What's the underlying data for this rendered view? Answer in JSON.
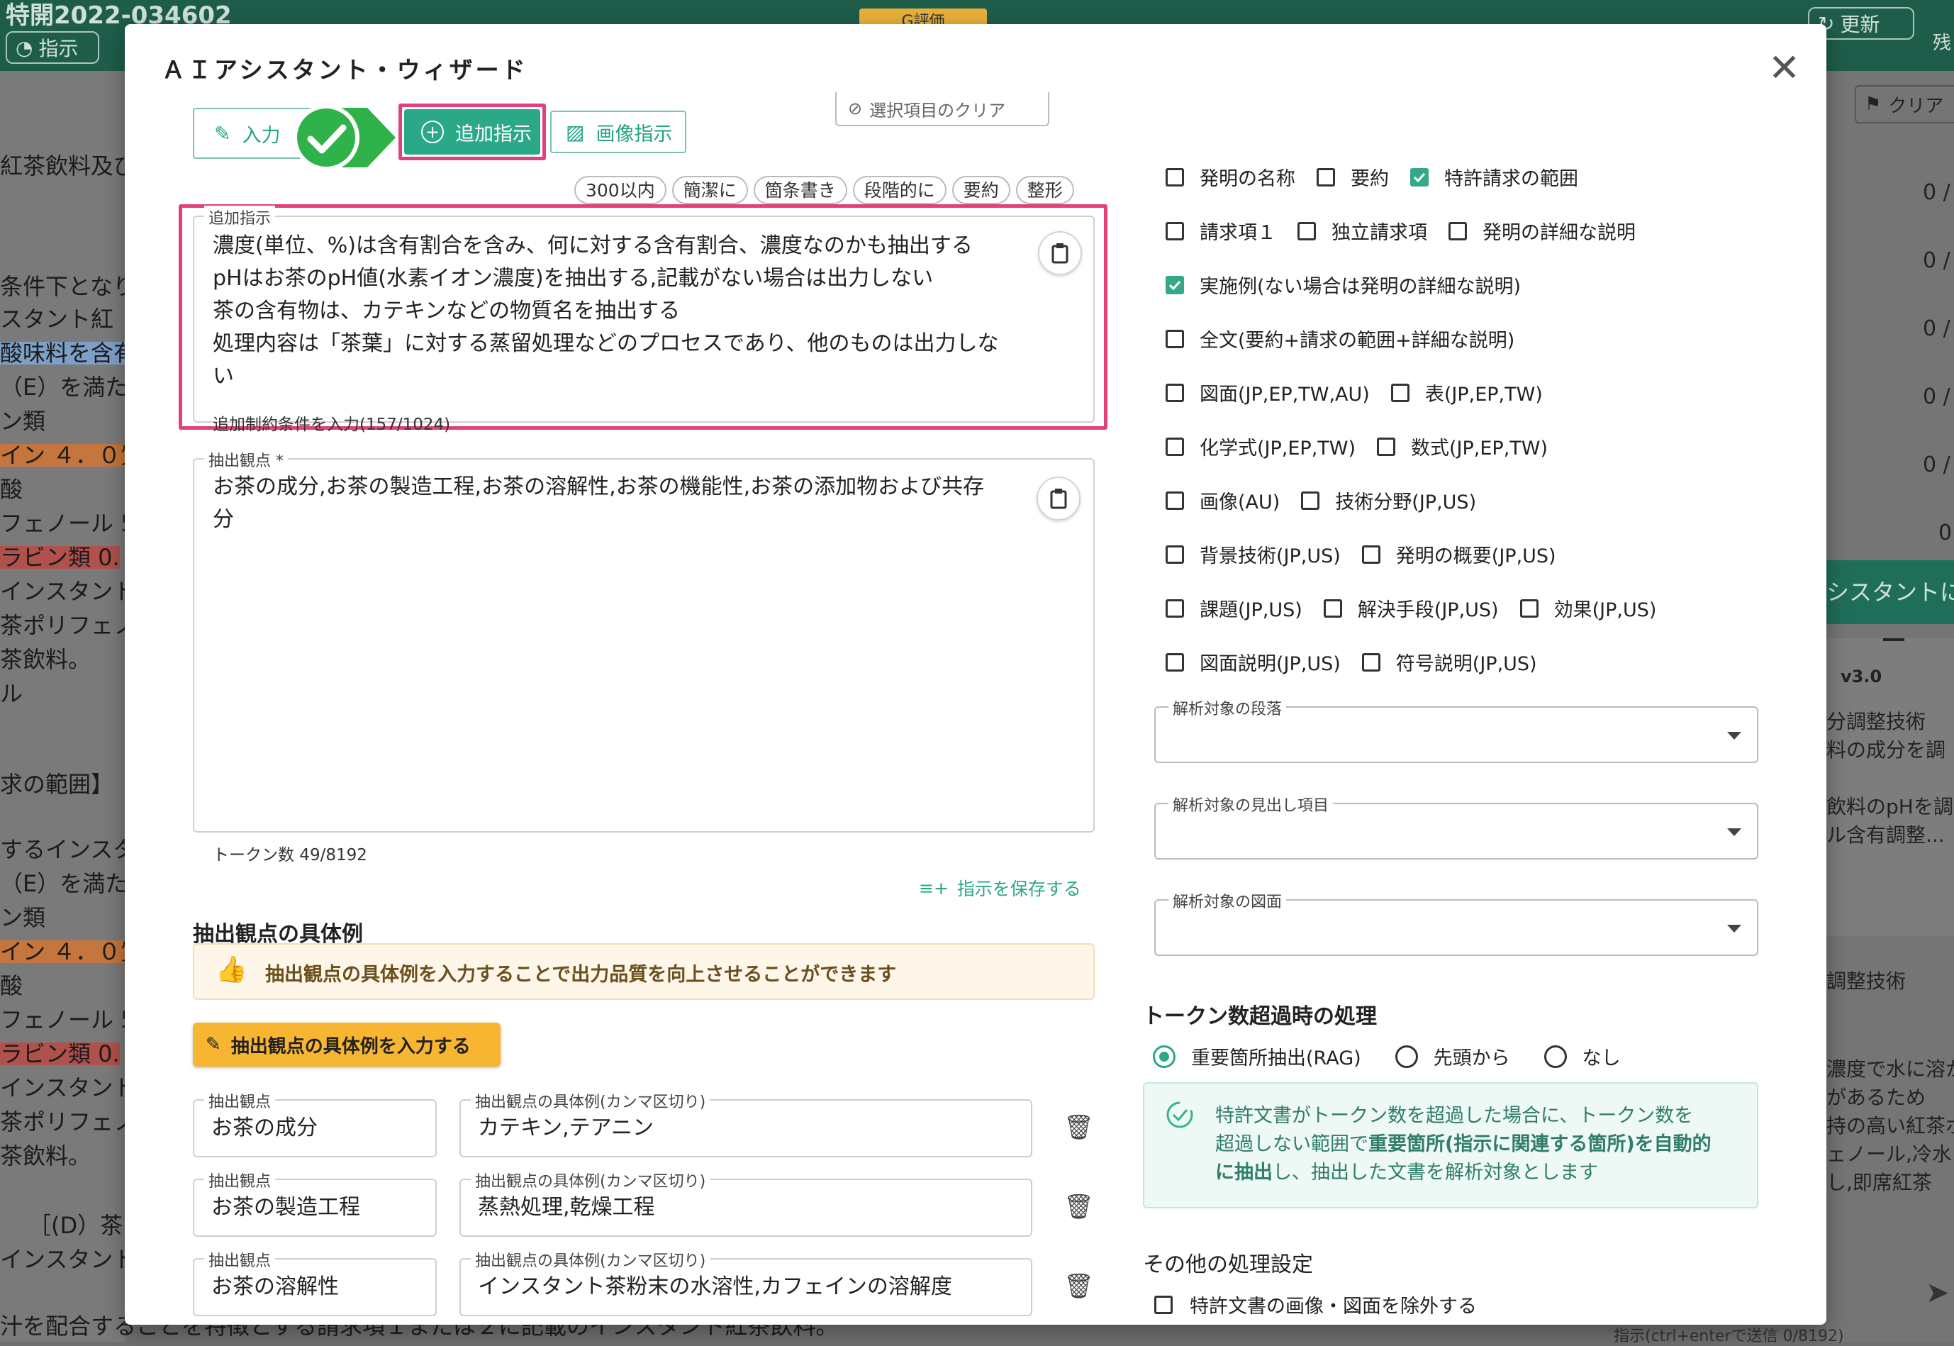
{
  "background": {
    "header_title": "特開2022-034602",
    "instruct_btn": "指示",
    "g_badge": "G評価",
    "update_btn": "更新",
    "right_cut": "残",
    "clear_btn": "クリア",
    "left_lines": [
      "紅茶飲料及び",
      "条件下となり",
      "スタント紅",
      "酸味料を含有",
      "（E）を満た",
      "ン類",
      "イン ４．０質",
      "酸",
      "フェノール 5",
      "ラビン類 0.",
      "インスタント",
      "茶ポリフェノ",
      "茶飲料。",
      "ル",
      "求の範囲】",
      "するインスタ",
      "（E）を満た",
      "ン類",
      "イン ４．０質",
      "酸",
      "フェノール 5",
      "ラビン類 0.",
      "インスタント",
      "茶ポリフェノ",
      "茶飲料。",
      "［(D）茶",
      "インスタント",
      "汁を配合することを特徴とする請求項１または２に記載のインスタント紅茶飲料。"
    ],
    "right_nums": [
      "0 /",
      "0 /",
      "0 /",
      "0 /",
      "0 /",
      "0"
    ],
    "right_banner": "シスタントに",
    "right_version": "v3.0",
    "right_lines": [
      "分調整技術",
      "料の成分を調",
      "",
      "飲料のpHを調",
      "ル含有調整..."
    ],
    "right_lower": [
      "調整技術",
      "",
      "",
      "濃度で水に溶か",
      "があるため",
      "持の高い紅茶ポリ",
      "ェノール,冷水",
      "し,即席紅茶"
    ],
    "bottom_right_hint": "指示(ctrl+enterで送信  0/8192)"
  },
  "modal": {
    "title": "ＡＩアシスタント・ウィザード",
    "tabs": {
      "input": "入力",
      "additional": "追加指示",
      "image": "画像指示"
    },
    "chips": [
      "300以内",
      "簡潔に",
      "箇条書き",
      "段階的に",
      "要約",
      "整形"
    ],
    "additional_field": {
      "label": "追加指示",
      "lines": [
        "濃度(単位、%)は含有割合を含み、何に対する含有割合、濃度なのかも抽出する",
        "pHはお茶のpH値(水素イオン濃度)を抽出する,記載がない場合は出力しない",
        "茶の含有物は、カテキンなどの物質名を抽出する",
        "処理内容は「茶葉」に対する蒸留処理などのプロセスであり、他のものは出力しな",
        "い"
      ],
      "helper": "追加制約条件を入力(157/1024)"
    },
    "perspective_field": {
      "label": "抽出観点 *",
      "lines": [
        "お茶の成分,お茶の製造工程,お茶の溶解性,お茶の機能性,お茶の添加物および共存",
        "分"
      ],
      "helper": "トークン数 49/8192"
    },
    "save_instruction": "指示を保存する",
    "examples": {
      "heading": "抽出観点の具体例",
      "tip": "抽出観点の具体例を入力することで出力品質を向上させることができます",
      "button": "抽出観点の具体例を入力する",
      "perspective_label": "抽出観点",
      "example_label": "抽出観点の具体例(カンマ区切り)",
      "rows": [
        {
          "perspective": "お茶の成分",
          "example": "カテキン,テアニン"
        },
        {
          "perspective": "お茶の製造工程",
          "example": "蒸熱処理,乾燥工程"
        },
        {
          "perspective": "お茶の溶解性",
          "example": "インスタント茶粉末の水溶性,カフェインの溶解度"
        }
      ]
    },
    "clear_selection": "選択項目のクリア",
    "checkboxes": [
      {
        "label": "発明の名称",
        "checked": false
      },
      {
        "label": "要約",
        "checked": false
      },
      {
        "label": "特許請求の範囲",
        "checked": true
      },
      {
        "label": "請求項１",
        "checked": false
      },
      {
        "label": "独立請求項",
        "checked": false
      },
      {
        "label": "発明の詳細な説明",
        "checked": false
      },
      {
        "label": "実施例(ない場合は発明の詳細な説明)",
        "checked": true
      },
      {
        "label": "全文(要約+請求の範囲+詳細な説明)",
        "checked": false
      },
      {
        "label": "図面(JP,EP,TW,AU)",
        "checked": false
      },
      {
        "label": "表(JP,EP,TW)",
        "checked": false
      },
      {
        "label": "化学式(JP,EP,TW)",
        "checked": false
      },
      {
        "label": "数式(JP,EP,TW)",
        "checked": false
      },
      {
        "label": "画像(AU)",
        "checked": false
      },
      {
        "label": "技術分野(JP,US)",
        "checked": false
      },
      {
        "label": "背景技術(JP,US)",
        "checked": false
      },
      {
        "label": "発明の概要(JP,US)",
        "checked": false
      },
      {
        "label": "課題(JP,US)",
        "checked": false
      },
      {
        "label": "解決手段(JP,US)",
        "checked": false
      },
      {
        "label": "効果(JP,US)",
        "checked": false
      },
      {
        "label": "図面説明(JP,US)",
        "checked": false
      },
      {
        "label": "符号説明(JP,US)",
        "checked": false
      }
    ],
    "selects": {
      "paragraph": "解析対象の段落",
      "heading_items": "解析対象の見出し項目",
      "figure": "解析対象の図面"
    },
    "token_overflow": {
      "heading": "トークン数超過時の処理",
      "options": [
        "重要箇所抽出(RAG)",
        "先頭から",
        "なし"
      ],
      "selected": "重要箇所抽出(RAG)",
      "info_line1": "特許文書がトークン数を超過した場合に、トークン数を",
      "info_line2a": "超過しない範囲で",
      "info_line2b": "重要箇所(指示に関連する箇所)を自動的",
      "info_line3a": "に抽出",
      "info_line3b": "し、抽出した文書を解析対象とします"
    },
    "other_settings": {
      "heading": "その他の処理設定",
      "exclude_images": "特許文書の画像・図面を除外する"
    }
  },
  "colors": {
    "accent": "#2aa887",
    "highlight_box": "#e2407c",
    "check_badge": "#2fb24a",
    "example_button": "#f7b531",
    "tip_background": "#fdf6e9"
  }
}
